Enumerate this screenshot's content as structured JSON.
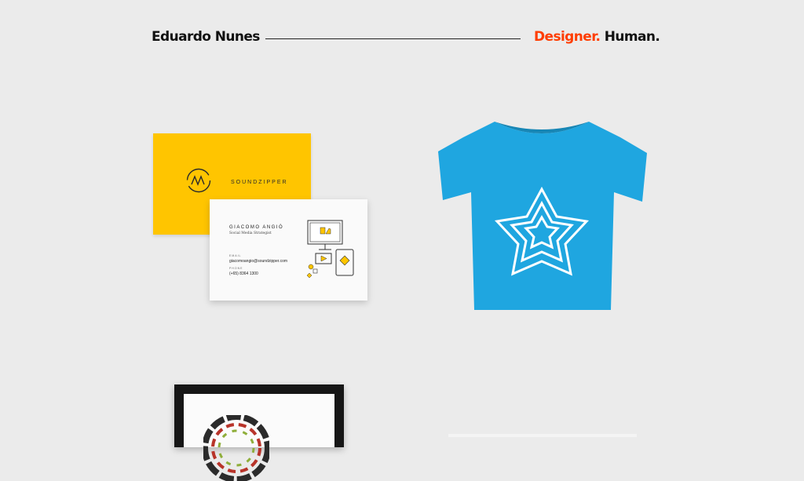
{
  "header": {
    "name": "Eduardo Nunes",
    "tagline_accent": "Designer.",
    "tagline_rest": "Human."
  },
  "colors": {
    "accent": "#ff3d00",
    "card_yellow": "#ffc500",
    "tee_blue": "#1fa6e0",
    "background": "#ebebeb"
  },
  "business_card": {
    "brand": "SOUNDZIPPER",
    "person_name": "GIACOMO ANGIÒ",
    "person_role": "Social Media Strategist",
    "email_label": "EMAIL",
    "email": "giacomoangio@soundzipper.com",
    "phone_label": "PHONE",
    "phone": "(+65) 8364 1300"
  },
  "portfolio": [
    {
      "name": "portfolio-business-cards"
    },
    {
      "name": "portfolio-tshirt"
    },
    {
      "name": "portfolio-frame"
    }
  ]
}
